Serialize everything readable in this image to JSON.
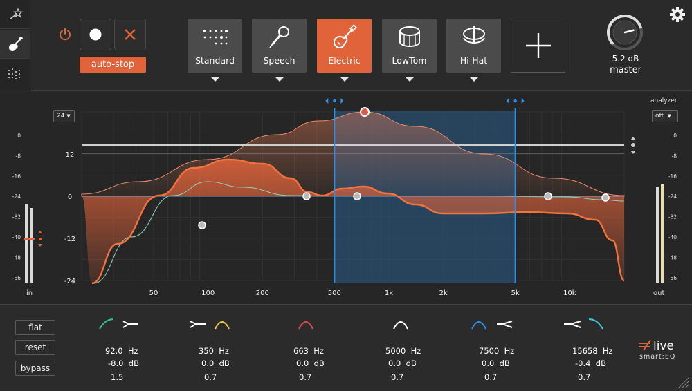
{
  "colors": {
    "accent": "#e0633a",
    "blue": "#2f8fe6",
    "panel": "#2b2b2b",
    "graph": "#262626"
  },
  "nav": {
    "items": [
      {
        "name": "magic-wand-icon"
      },
      {
        "name": "guitar-icon"
      },
      {
        "name": "eq-grid-icon"
      }
    ]
  },
  "controls": {
    "power_icon": "power-icon",
    "record_icon": "record-icon",
    "cancel_icon": "x-icon",
    "autostop_label": "auto-stop"
  },
  "profiles": [
    {
      "label": "Standard",
      "icon": "dots-icon",
      "active": false
    },
    {
      "label": "Speech",
      "icon": "microphone-icon",
      "active": false
    },
    {
      "label": "Electric",
      "icon": "electric-guitar-icon",
      "active": true
    },
    {
      "label": "LowTom",
      "icon": "drum-icon",
      "active": false
    },
    {
      "label": "Hi-Hat",
      "icon": "hihat-icon",
      "active": false
    }
  ],
  "add_profile_icon": "plus-icon",
  "master": {
    "gain": "5.2 dB",
    "label": "master",
    "knob_fraction": 0.78
  },
  "settings_icon": "gear-icon",
  "graph": {
    "range_value": "24",
    "analyzer_label": "analyzer",
    "analyzer_value": "off",
    "gain_ticks": [
      "12",
      "0",
      "-12",
      "-24"
    ],
    "freq_ticks": [
      {
        "f": 50,
        "label": "50"
      },
      {
        "f": 100,
        "label": "100"
      },
      {
        "f": 200,
        "label": "200"
      },
      {
        "f": 500,
        "label": "500"
      },
      {
        "f": 1000,
        "label": "1k"
      },
      {
        "f": 2000,
        "label": "2k"
      },
      {
        "f": 5000,
        "label": "5k"
      },
      {
        "f": 10000,
        "label": "10k"
      }
    ],
    "selection_hz": [
      500,
      5000
    ],
    "meter_in_label": "in",
    "meter_out_label": "out",
    "meter_ticks": [
      "0",
      "-8",
      "-16",
      "-24",
      "-32",
      "-40",
      "-48",
      "-56"
    ]
  },
  "bands": [
    {
      "freq": "92.0",
      "freq_unit": "Hz",
      "gain": "-8.0",
      "gain_unit": "dB",
      "q": "1.5",
      "color": "#3fbf8f"
    },
    {
      "freq": "350",
      "freq_unit": "Hz",
      "gain": "0.0",
      "gain_unit": "dB",
      "q": "0.7",
      "color": "#e8c63a"
    },
    {
      "freq": "663",
      "freq_unit": "Hz",
      "gain": "0.0",
      "gain_unit": "dB",
      "q": "0.7",
      "color": "#e04a4a"
    },
    {
      "freq": "5000",
      "freq_unit": "Hz",
      "gain": "0.0",
      "gain_unit": "dB",
      "q": "0.7",
      "color": "#ffffff"
    },
    {
      "freq": "7500",
      "freq_unit": "Hz",
      "gain": "0.0",
      "gain_unit": "dB",
      "q": "0.7",
      "color": "#2f8fe6"
    },
    {
      "freq": "15658",
      "freq_unit": "Hz",
      "gain": "-0.4",
      "gain_unit": "dB",
      "q": "0.7",
      "color": "#3fc7d8"
    }
  ],
  "buttons": {
    "flat": "flat",
    "reset": "reset",
    "bypass": "bypass"
  },
  "brand": {
    "name": "live",
    "sub": "smart:EQ"
  }
}
